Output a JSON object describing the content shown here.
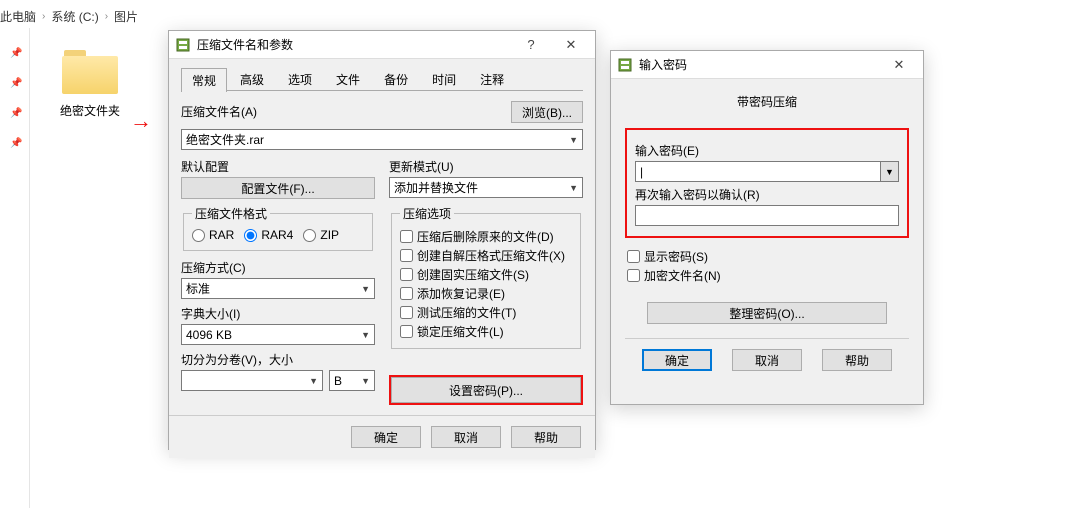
{
  "breadcrumb": {
    "a": "此电脑",
    "b": "系统 (C:)",
    "c": "图片"
  },
  "folder": {
    "name": "绝密文件夹"
  },
  "archive": {
    "title": "压缩文件名和参数",
    "tabs": [
      "常规",
      "高级",
      "选项",
      "文件",
      "备份",
      "时间",
      "注释"
    ],
    "filename_label": "压缩文件名(A)",
    "browse": "浏览(B)...",
    "filename_value": "绝密文件夹.rar",
    "profile_label": "默认配置",
    "profile_btn": "配置文件(F)...",
    "update_label": "更新模式(U)",
    "update_value": "添加并替换文件",
    "format_label": "压缩文件格式",
    "formats": {
      "rar": "RAR",
      "rar4": "RAR4",
      "zip": "ZIP"
    },
    "method_label": "压缩方式(C)",
    "method_value": "标准",
    "dict_label": "字典大小(I)",
    "dict_value": "4096 KB",
    "split_label": "切分为分卷(V)，大小",
    "split_unit": "B",
    "options_label": "压缩选项",
    "opts": {
      "del": "压缩后删除原来的文件(D)",
      "sfx": "创建自解压格式压缩文件(X)",
      "solid": "创建固实压缩文件(S)",
      "recov": "添加恢复记录(E)",
      "test": "测试压缩的文件(T)",
      "lock": "锁定压缩文件(L)"
    },
    "set_pw": "设置密码(P)...",
    "ok": "确定",
    "cancel": "取消",
    "help": "帮助"
  },
  "pw": {
    "title": "输入密码",
    "header": "带密码压缩",
    "enter": "输入密码(E)",
    "confirm": "再次输入密码以确认(R)",
    "show": "显示密码(S)",
    "encnames": "加密文件名(N)",
    "organize": "整理密码(O)...",
    "ok": "确定",
    "cancel": "取消",
    "help": "帮助"
  }
}
